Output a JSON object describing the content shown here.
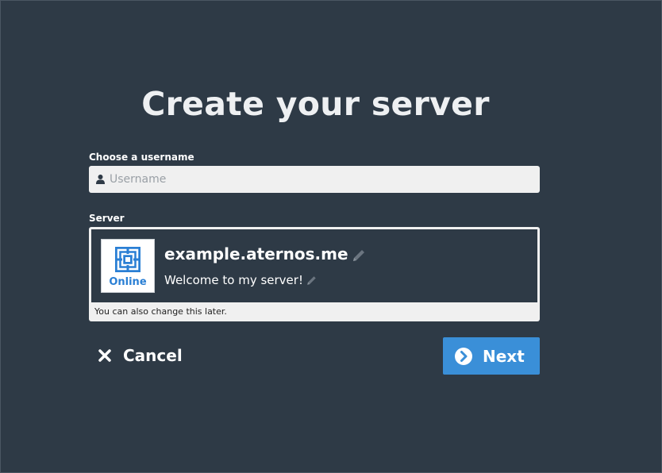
{
  "page": {
    "title": "Create your server"
  },
  "username": {
    "label": "Choose a username",
    "placeholder": "Username",
    "value": ""
  },
  "server": {
    "label": "Server",
    "status": "Online",
    "address": "example.aternos.me",
    "motd": "Welcome to my server!",
    "hint": "You can also change this later."
  },
  "actions": {
    "cancel_label": "Cancel",
    "next_label": "Next"
  },
  "icons": {
    "user": "user-icon",
    "status_logo": "aternos-logo-icon",
    "edit": "pencil-icon",
    "cancel": "close-icon",
    "next": "chevron-right-circle-icon"
  },
  "colors": {
    "background": "#2e3a46",
    "accent": "#3a8fd8",
    "status_online": "#2a7fd4"
  }
}
